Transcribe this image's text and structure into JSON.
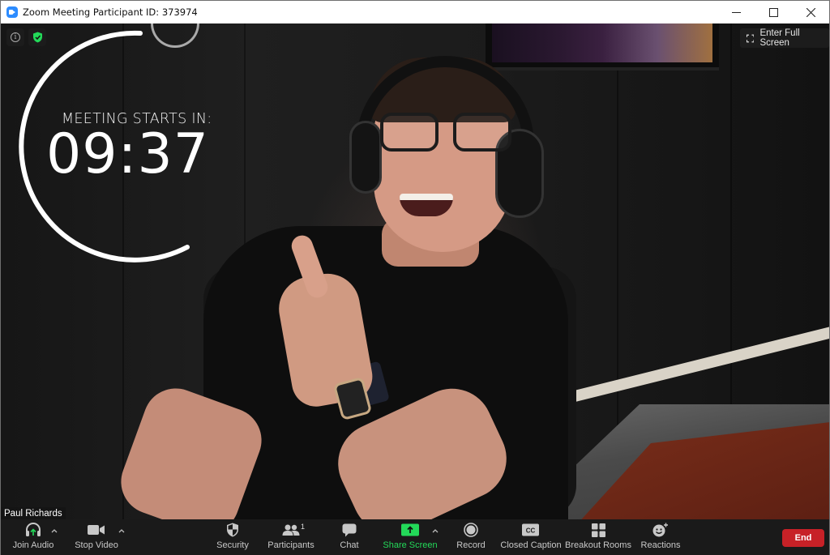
{
  "window": {
    "title": "Zoom Meeting Participant ID: 373974",
    "controls": {
      "minimize": "minimize",
      "maximize": "maximize",
      "close": "close"
    }
  },
  "video": {
    "fullscreen_label": "Enter Full Screen",
    "participant_name": "Paul Richards",
    "countdown": {
      "label": "MEETING STARTS IN:",
      "time": "09:37"
    },
    "security_badge_color": "#23d959"
  },
  "toolbar": {
    "join_audio": "Join Audio",
    "stop_video": "Stop Video",
    "security": "Security",
    "participants": "Participants",
    "participants_count": "1",
    "chat": "Chat",
    "share_screen": "Share Screen",
    "record": "Record",
    "closed_caption": "Closed Caption",
    "closed_caption_glyph": "CC",
    "breakout_rooms": "Breakout Rooms",
    "reactions": "Reactions",
    "end": "End"
  },
  "colors": {
    "accent_green": "#23d959",
    "end_red": "#c72127",
    "zoom_blue": "#2d8cff"
  }
}
